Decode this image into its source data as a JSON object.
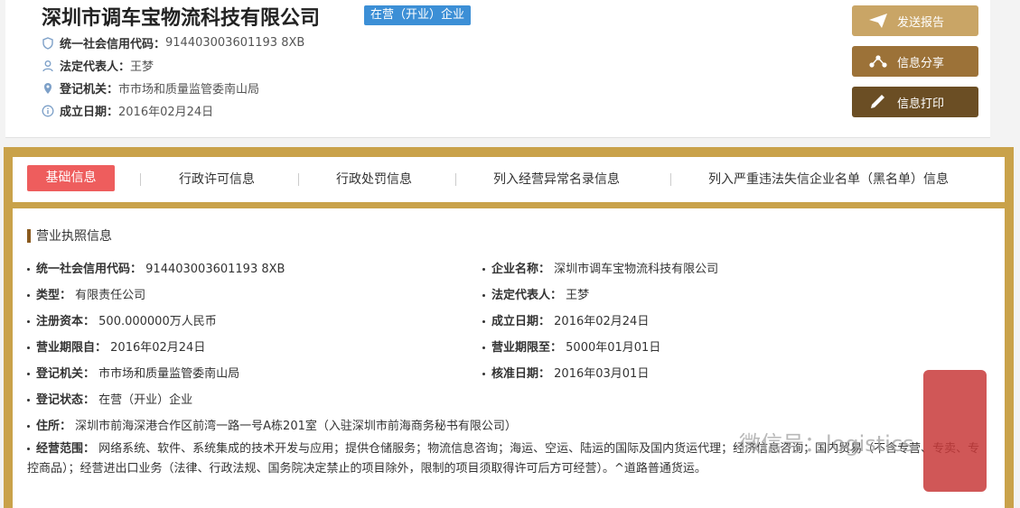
{
  "header": {
    "company_name": "深圳市调车宝物流科技有限公司",
    "status_badge": "在营（开业）企业",
    "credit_code_label": "统一社会信用代码：",
    "credit_code": "914403003601193 8XB",
    "legal_rep_label": "法定代表人：",
    "legal_rep": "王梦",
    "authority_label": "登记机关：",
    "authority": "市市场和质量监管委南山局",
    "founded_label": "成立日期：",
    "founded": "2016年02月24日"
  },
  "actions": {
    "report": "发送报告",
    "share": "信息分享",
    "print": "信息打印"
  },
  "tabs": [
    {
      "label": "基础信息",
      "active": true
    },
    {
      "label": "行政许可信息"
    },
    {
      "label": "行政处罚信息"
    },
    {
      "label": "列入经营异常名录信息"
    },
    {
      "label": "列入严重违法失信企业名单（黑名单）信息"
    }
  ],
  "license": {
    "section_title": "营业执照信息",
    "fields": {
      "credit_code": {
        "k": "统一社会信用代码：",
        "v": "914403003601193 8XB"
      },
      "company_name": {
        "k": "企业名称：",
        "v": "深圳市调车宝物流科技有限公司"
      },
      "type": {
        "k": "类型：",
        "v": "有限责任公司"
      },
      "legal_rep": {
        "k": "法定代表人：",
        "v": "王梦"
      },
      "capital": {
        "k": "注册资本：",
        "v": "500.000000万人民币"
      },
      "founded": {
        "k": "成立日期：",
        "v": "2016年02月24日"
      },
      "term_from": {
        "k": "营业期限自：",
        "v": "2016年02月24日"
      },
      "term_to": {
        "k": "营业期限至：",
        "v": "5000年01月01日"
      },
      "authority": {
        "k": "登记机关：",
        "v": "市市场和质量监管委南山局"
      },
      "approved": {
        "k": "核准日期：",
        "v": "2016年03月01日"
      },
      "status": {
        "k": "登记状态：",
        "v": "在营（开业）企业"
      },
      "address": {
        "k": "住所：",
        "v": "深圳市前海深港合作区前湾一路一号A栋201室（入驻深圳市前海商务秘书有限公司）"
      },
      "scope": {
        "k": "经营范围：",
        "v": "网络系统、软件、系统集成的技术开发与应用；提供仓储服务；物流信息咨询；海运、空运、陆运的国际及国内货运代理；经济信息咨询；国内贸易（不含专营、专卖、专控商品）；经营进出口业务（法律、行政法规、国务院决定禁止的项目除外，限制的项目须取得许可后方可经营）。^道路普通货运。"
      }
    }
  },
  "watermark": "微信号：logistics",
  "colors": {
    "badge": "#3c8fd6",
    "tab_active": "#ee5d5d",
    "panel_border": "#c9a24a",
    "btn_report": "#c9a566",
    "btn_share": "#9c7238",
    "btn_print": "#6b4e24"
  }
}
